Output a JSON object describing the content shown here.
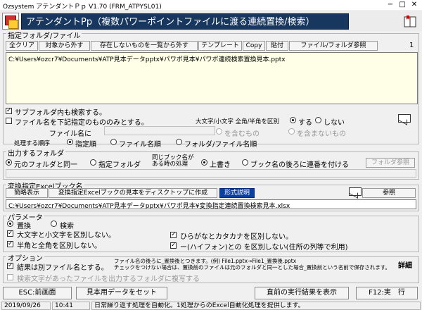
{
  "window": {
    "title": "Ozsystem アテンダントＰｐ V1.70 (FRM_ATPYSL01)",
    "minimize": "−",
    "maximize": "□",
    "close": "✕"
  },
  "header": {
    "banner": "アテンダントPp（複数パワーポイントファイルに渡る連続置換/検索）"
  },
  "folder_section": {
    "label": "指定フォルダ/ファイル",
    "toolbar": {
      "clear_all": "全クリア",
      "remove_from_target": "対象から外す",
      "remove_missing": "存在しないものを一覧から外す",
      "template": "テンプレート",
      "copy": "Copy",
      "paste": "貼付",
      "browse": "ファイル/フォルダ参照"
    },
    "count": "1",
    "path": "C:¥Users¥ozcr7¥Documents¥ATP見本データpptx¥パワポ見本¥パワポ連続検索置換見本.pptx",
    "include_subfolders": "サブフォルダ内も検索する。",
    "filter_by_name": "ファイル名を下記指定のもののみとする。",
    "case_width_note": "大文字/小文字 全角/半角を区別",
    "radio_yes": "する",
    "radio_no": "しない",
    "file_name_label": "ファイル名に",
    "contains": "を含むもの",
    "not_contains": "を含まないもの",
    "order_label": "処理する順序",
    "order_specified": "指定順",
    "order_filename": "ファイル名順",
    "order_folder_filename": "フォルダ/ファイル名順"
  },
  "output_section": {
    "label": "出力するフォルダ",
    "same_as_original": "元のフォルダと同一",
    "specified_folder": "指定フォルダ",
    "same_name_line1": "同じブック名が",
    "same_name_line2": "ある時の処理",
    "overwrite": "上書き",
    "append_number": "ブック名の後ろに連番を付ける",
    "folder_browse": "フォルダ参照"
  },
  "excel_section": {
    "label": "変換指定Excelブック名",
    "short_display": "簡略表示",
    "create_sample": "変換指定Excelブックの見本をディスクトップに作成",
    "format_desc": "形式説明",
    "browse": "参照",
    "path": "C:¥Users¥ozcr7¥Documents¥ATP見本データpptx¥パワポ見本¥変換指定連続置換検索見本.xlsx"
  },
  "params_section": {
    "label": "パラメータ",
    "replace": "置換",
    "search": "検索",
    "case_sensitive": "大文字と小文字を区別しない。",
    "width_sensitive": "半角と全角を区別しない。",
    "kana_sensitive": "ひらがなとカタカナを区別しない。",
    "hyphen_sensitive": "ー(ハイフォン)との を区別しない(住所の列等で利用)"
  },
  "options_section": {
    "label": "オプション",
    "result_separate": "結果は別ファイル名とする。",
    "note_line1": "ファイル名の後ろに_置換後とつきます。(例) File1.pptx→File1_置換後.pptx",
    "note_line2": "チェックをつけない場合は、置換前のファイルは元のフォルダと同一とした場合_置換前という名前で保存されます。",
    "detail": "詳細",
    "output_matched": "検索文字があったファイルを出力するフォルダに複写する"
  },
  "bottom_buttons": {
    "esc": "ESC:前画面",
    "set_sample": "見本用データをセット",
    "show_previous": "直前の実行結果を表示",
    "run": "F12:実　行"
  },
  "statusbar": {
    "date": "2019/09/26",
    "time": "10:41",
    "message": "日常繰り返す処理を自動化。1処理からのExcel自動化処理を提供します。"
  }
}
